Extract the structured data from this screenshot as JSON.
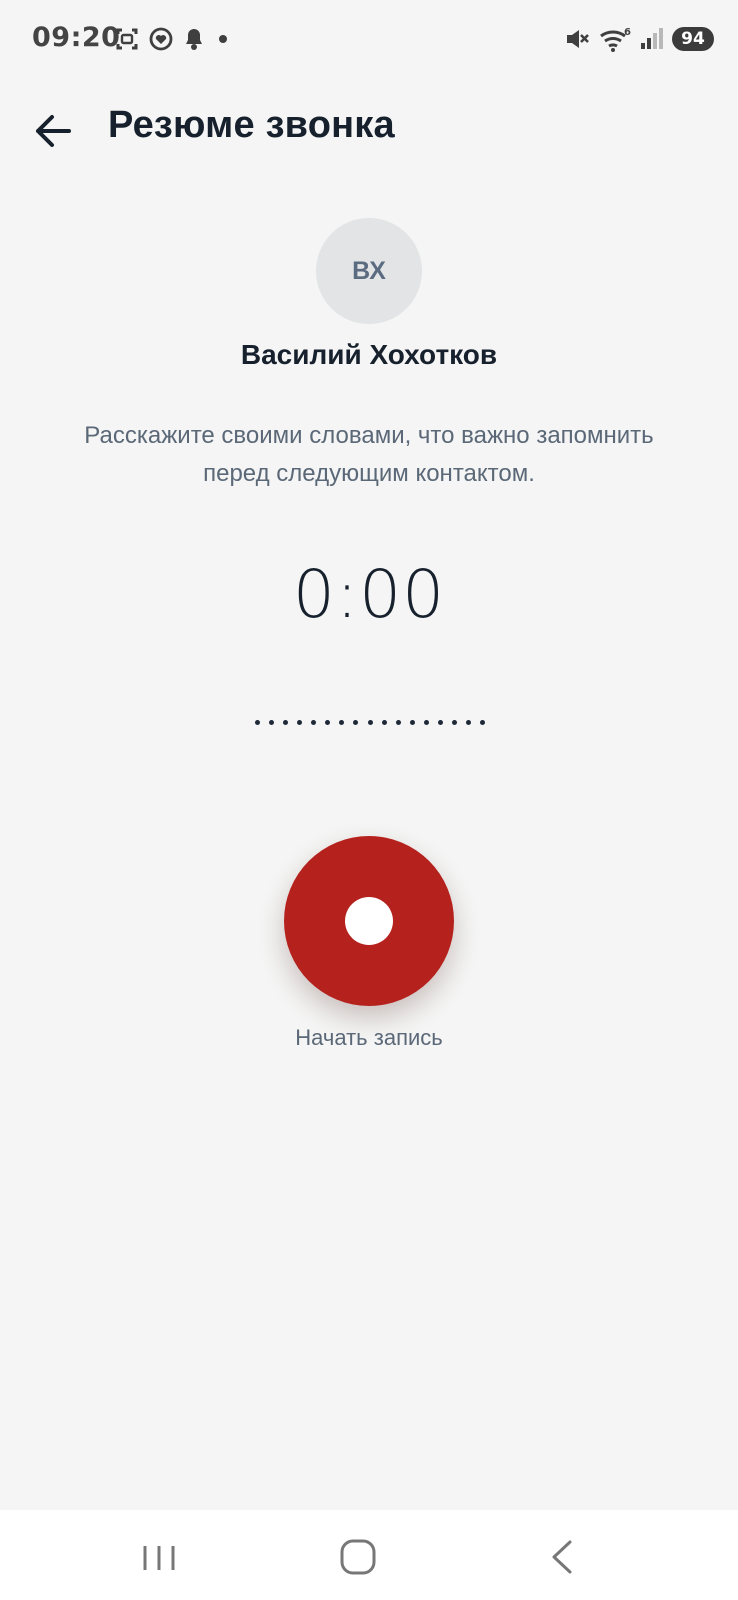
{
  "status_bar": {
    "time": "09:20",
    "battery": "94",
    "wifi_label": "6",
    "icons": [
      "screenshot-icon",
      "health-icon",
      "notification-bell-icon",
      "dot-indicator-icon",
      "mute-icon",
      "wifi-icon",
      "signal-icon",
      "battery-icon"
    ]
  },
  "header": {
    "title": "Резюме звонка",
    "back_icon": "arrow-left-icon"
  },
  "contact": {
    "initials": "ВХ",
    "name": "Василий Хохотков"
  },
  "instruction": "Расскажите своими словами, что важно запомнить перед следующим контактом.",
  "recorder": {
    "timer": "0:00",
    "waveform_points": 17,
    "button_label": "Начать запись",
    "button_color": "#b5221d",
    "accent_color": "#17202d"
  },
  "nav_bar": {
    "buttons": [
      "recent-apps-icon",
      "home-icon",
      "back-icon"
    ]
  }
}
